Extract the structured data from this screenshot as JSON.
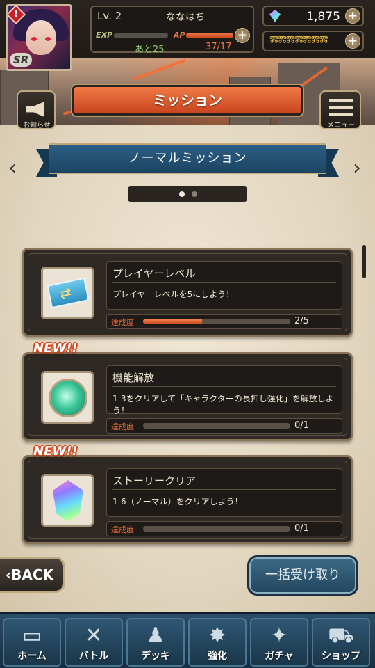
{
  "player": {
    "level": "Lv. 2",
    "name": "ななはち",
    "rank": "SR",
    "alert": "!",
    "exp_label": "EXP",
    "exp_next": "あと25",
    "ap_label": "AP",
    "ap_value": "37/17",
    "ap_fill": 1.0
  },
  "currency": {
    "gems": "1,875",
    "keys": "ⰿⰿⰿⰿⰿⰿⰿ",
    "plus": "+"
  },
  "header": {
    "title": "ミッション",
    "notice_label": "お知らせ",
    "menu_label": "メニュー"
  },
  "category": {
    "title": "ノーマルミッション",
    "prev": "‹",
    "next": "›",
    "pages": 2,
    "current_page": 1
  },
  "missions": [
    {
      "title": "プレイヤーレベル",
      "description": "プレイヤーレベルを5にしよう！",
      "progress_label": "達成度",
      "progress_text": "2/5",
      "progress": 0.4,
      "new": false,
      "icon": "ticket-icon"
    },
    {
      "title": "機能解放",
      "description": "1-3をクリアして「キャラクターの長押し強化」を解放しよう！",
      "progress_label": "達成度",
      "progress_text": "0/1",
      "progress": 0,
      "new": true,
      "new_label": "NEW!!",
      "icon": "orb-icon"
    },
    {
      "title": "ストーリークリア",
      "description": "1-6（ノーマル）をクリアしよう！",
      "progress_label": "達成度",
      "progress_text": "0/1",
      "progress": 0,
      "new": true,
      "new_label": "NEW!!",
      "icon": "crystal-icon"
    }
  ],
  "actions": {
    "back": "BACK",
    "collect_all": "一括受け取り"
  },
  "nav": [
    {
      "label": "ホーム",
      "icon": "home-icon"
    },
    {
      "label": "バトル",
      "icon": "battle-icon"
    },
    {
      "label": "デッキ",
      "icon": "deck-icon"
    },
    {
      "label": "強化",
      "icon": "enhance-icon"
    },
    {
      "label": "ガチャ",
      "icon": "gacha-icon"
    },
    {
      "label": "ショップ",
      "icon": "shop-icon"
    }
  ],
  "colors": {
    "accent_orange": "#f07a46",
    "ribbon_blue": "#2d5f85",
    "parchment": "#e2d6bf",
    "nav_blue": "#2c4d66"
  }
}
